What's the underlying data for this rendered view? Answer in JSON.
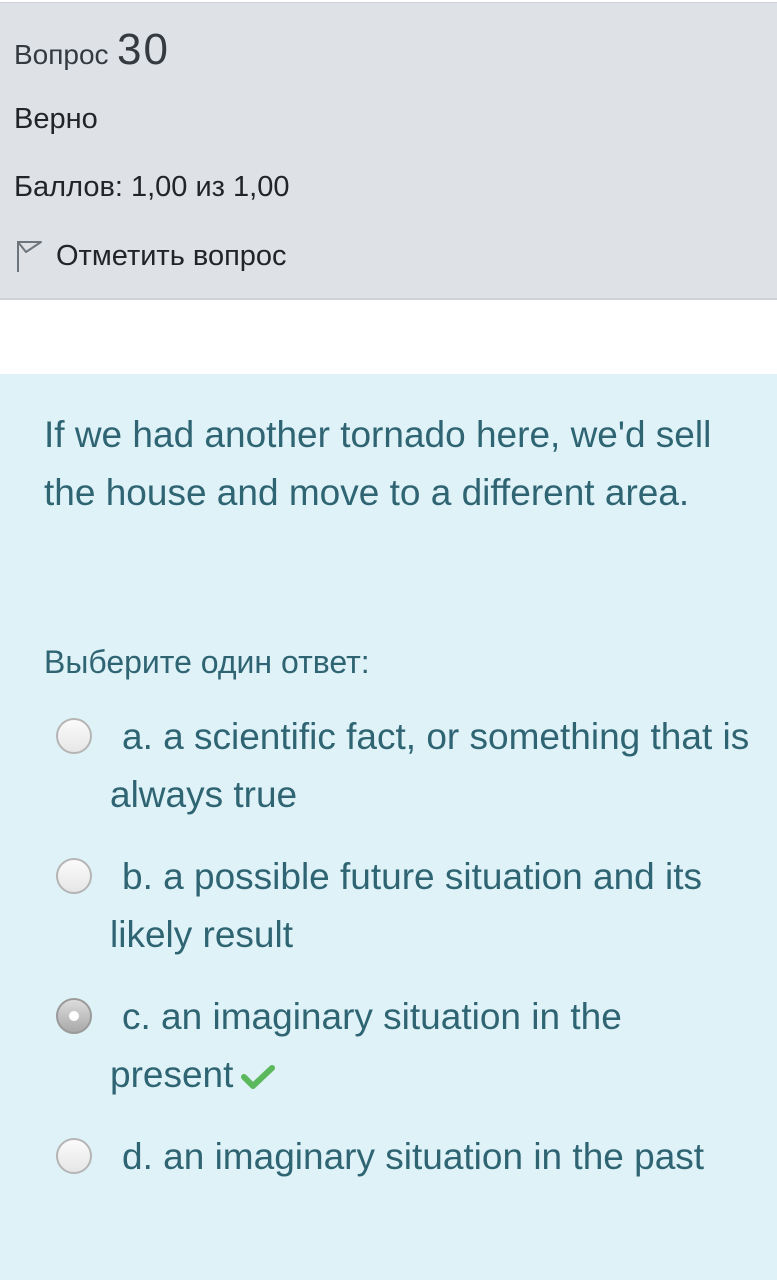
{
  "question_info": {
    "number_label": "Вопрос",
    "number": "30",
    "state": "Верно",
    "grade": "Баллов: 1,00 из 1,00",
    "flag_label": "Отметить вопрос"
  },
  "question": {
    "text": "If we had another tornado here, we'd sell the house and move to a different area.",
    "prompt": "Выберите один ответ:",
    "answers": [
      {
        "label": "a. a scientific fact, or something that is always true",
        "selected": false,
        "correct": false
      },
      {
        "label": "b. a possible future situation and its likely result",
        "selected": false,
        "correct": false
      },
      {
        "label": "c. an imaginary situation in the present",
        "selected": true,
        "correct": true
      },
      {
        "label": "d. an imaginary situation in the past",
        "selected": false,
        "correct": false
      }
    ]
  },
  "colors": {
    "info_bg": "#dee2e6",
    "content_bg": "#def2f8",
    "content_text": "#2f6473",
    "correct_check": "#5cb85c"
  },
  "icons": {
    "flag": "flag-icon",
    "correct": "checkmark-icon",
    "radio": "radio-button"
  }
}
